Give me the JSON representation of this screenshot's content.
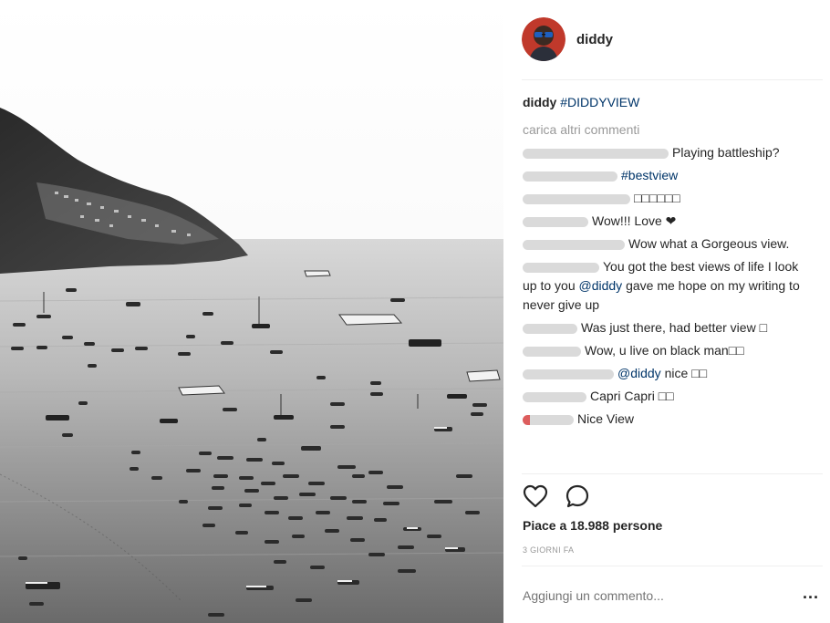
{
  "post": {
    "author": "diddy",
    "caption_user": "diddy",
    "caption_text": "#DIDDYVIEW",
    "load_more": "carica altri commenti",
    "comments": [
      {
        "user_redacted": true,
        "text": "Playing battleship?"
      },
      {
        "user_redacted": true,
        "text": "#bestview"
      },
      {
        "user_redacted": true,
        "text": "□□□□□□"
      },
      {
        "user_redacted": true,
        "text": "Wow!!! Love ❤"
      },
      {
        "user_redacted": true,
        "text": "Wow what a Gorgeous view."
      },
      {
        "user_redacted": true,
        "user_suffix": "_",
        "text": "You got the best views of life I look up to you ",
        "mention": "@diddy",
        "text2": " gave me hope on my writing to never give up"
      },
      {
        "user_redacted": true,
        "text": "Was just there, had better view □"
      },
      {
        "user_redacted": true,
        "text": "Wow, u live on black man□□"
      },
      {
        "user_redacted": true,
        "user_suffix": "_",
        "mention": "@diddy",
        "text": " nice □□"
      },
      {
        "user_redacted": true,
        "text": "Capri Capri □□"
      },
      {
        "user_redacted": true,
        "text": "Nice View"
      }
    ],
    "likes": "Piace a 18.988 persone",
    "timestamp": "3 GIORNI FA",
    "add_comment_placeholder": "Aggiungi un commento...",
    "more_label": "..."
  },
  "icons": {
    "like": "heart-icon",
    "comment": "comment-bubble-icon",
    "options": "more-options-icon"
  },
  "colors": {
    "link": "#003569",
    "muted": "#999999",
    "text": "#262626",
    "avatar_bg": "#c0392b"
  }
}
